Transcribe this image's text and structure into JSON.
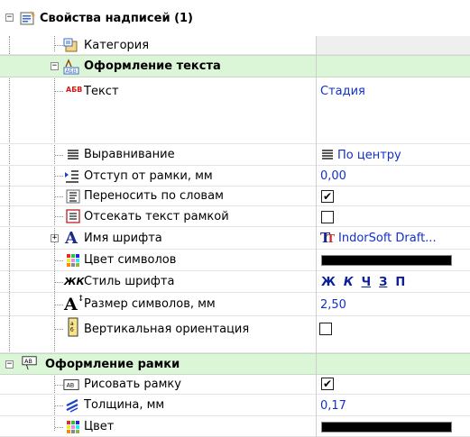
{
  "grid": {
    "title": "Свойства надписей (1)",
    "category": "Категория",
    "text_section": {
      "title": "Оформление текста",
      "text_label": "Текст",
      "text_icon_glyph": "АБВ",
      "text_value": "Стадия",
      "align_label": "Выравнивание",
      "align_value": "По центру",
      "indent_label": "Отступ от рамки, мм",
      "indent_value": "0,00",
      "wrap_label": "Переносить по словам",
      "wrap_checked": true,
      "clip_label": "Отсекать текст рамкой",
      "clip_checked": false,
      "font_label": "Имя шрифта",
      "font_value": "IndorSoft Draft...",
      "color_label": "Цвет символов",
      "color_value": "#000000",
      "style_label": "Стиль шрифта",
      "style_icon_glyph": "ЖК",
      "style_chars": [
        "Ж",
        "К",
        "Ч",
        "З",
        "П"
      ],
      "size_label": "Размер символов, мм",
      "size_value": "2,50",
      "vertical_label": "Вертикальная ориентация",
      "vertical_checked": false
    },
    "frame_section": {
      "title": "Оформление рамки",
      "draw_label": "Рисовать рамку",
      "draw_checked": true,
      "thickness_label": "Толщина, мм",
      "thickness_value": "0,17",
      "color_label": "Цвет",
      "color_value": "#000000"
    },
    "expand_glyph": "+",
    "collapse_glyph": "−",
    "check_glyph": "✔"
  },
  "colors": {
    "section_bg": "#dbf6d6",
    "value_blue": "#1330c8",
    "value_gray_bg": "#efefef"
  },
  "icons": {
    "root": "properties-icon",
    "category": "category-icon",
    "text_section": "text-abc-icon",
    "text": "abc-red-icon",
    "align": "align-center-icon",
    "indent": "indent-icon",
    "wrap": "word-wrap-icon",
    "clip": "clip-text-icon",
    "font": "font-a-icon",
    "truetype": "truetype-font-icon",
    "color": "color-palette-icon",
    "style": "font-style-icon",
    "size": "font-size-icon",
    "vertical": "vertical-text-icon",
    "frame": "frame-ab-icon",
    "thickness": "line-thickness-icon"
  }
}
